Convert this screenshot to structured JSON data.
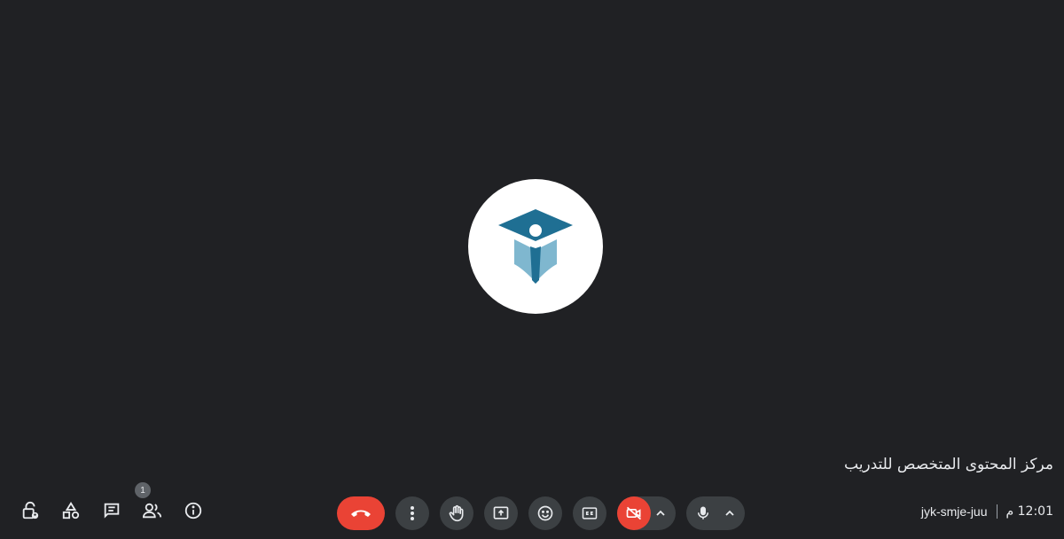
{
  "participant": {
    "name": "مركز المحتوى المتخصص للتدريب",
    "avatar_icon": "organization-logo-icon"
  },
  "meeting": {
    "time": "12:01 م",
    "code": "jyk-smje-juu"
  },
  "controls": [
    {
      "name": "hangup-button",
      "icon": "phone-hangup-icon"
    },
    {
      "name": "more-options-button",
      "icon": "more-vert-icon"
    },
    {
      "name": "raise-hand-button",
      "icon": "hand-icon"
    },
    {
      "name": "present-screen-button",
      "icon": "present-icon"
    },
    {
      "name": "reactions-button",
      "icon": "emoji-icon"
    },
    {
      "name": "captions-button",
      "icon": "closed-captions-icon"
    },
    {
      "name": "camera-toggle-button",
      "icon": "camera-off-icon",
      "state": "off"
    },
    {
      "name": "microphone-toggle-button",
      "icon": "mic-icon",
      "state": "on"
    }
  ],
  "side_tools": [
    {
      "name": "host-controls-button",
      "icon": "lock-person-icon"
    },
    {
      "name": "activities-button",
      "icon": "shapes-icon"
    },
    {
      "name": "chat-button",
      "icon": "chat-icon"
    },
    {
      "name": "people-button",
      "icon": "people-icon",
      "badge": "1"
    },
    {
      "name": "meeting-details-button",
      "icon": "info-icon"
    }
  ],
  "colors": {
    "background": "#202124",
    "control": "#3c4043",
    "danger": "#ea4335",
    "logo_dark": "#1f6f93",
    "logo_light": "#7fb7cf"
  }
}
